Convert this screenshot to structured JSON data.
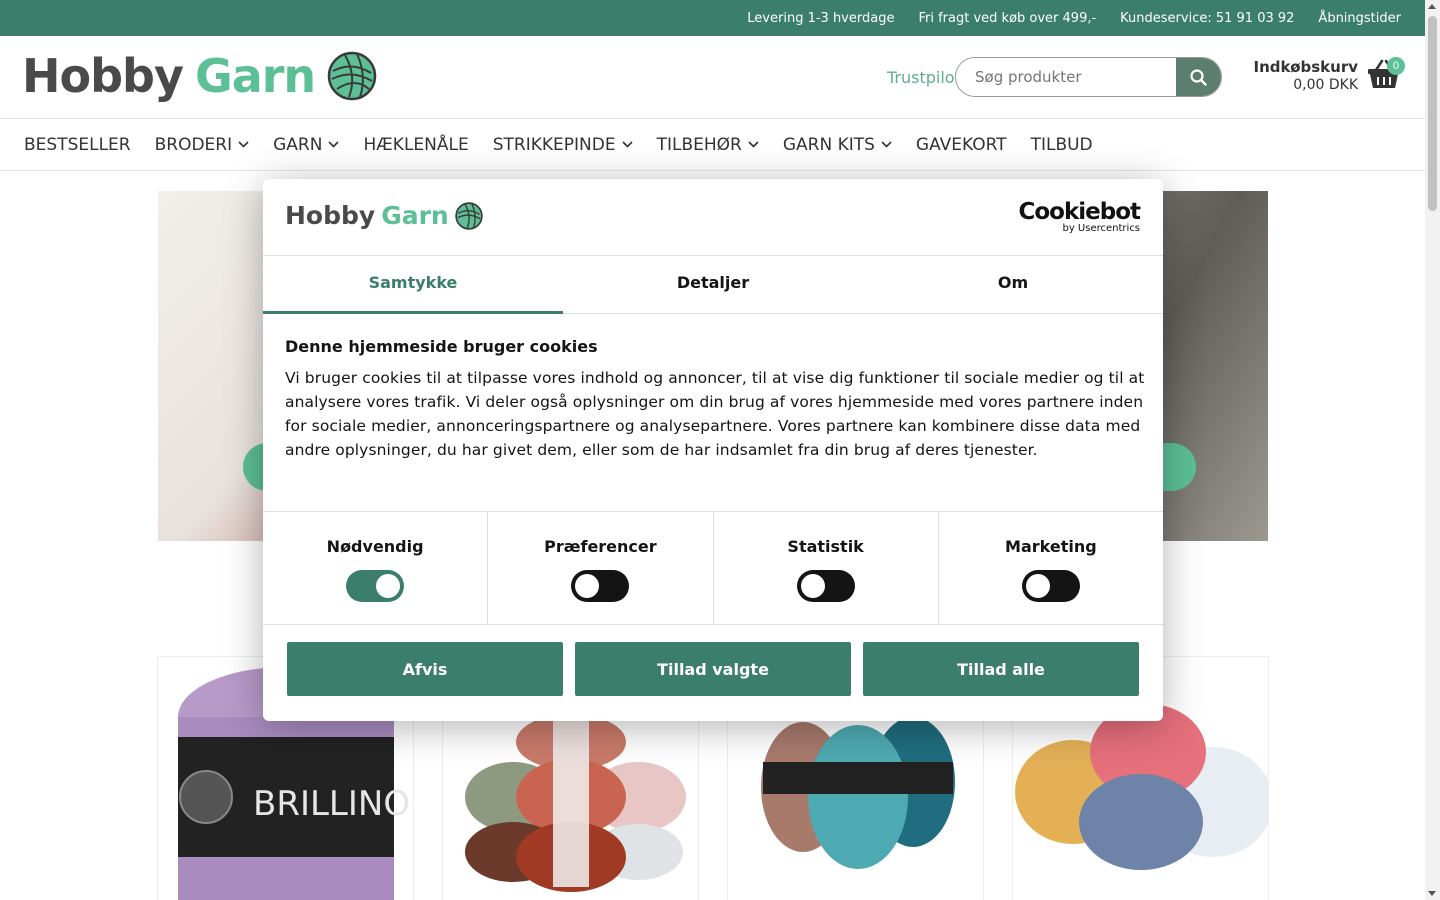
{
  "topbar": {
    "delivery": "Levering 1-3 hverdage",
    "free_shipping": "Fri fragt ved køb over 499,-",
    "customer_service": "Kundeservice: 51 91 03 92",
    "opening_hours": "Åbningstider"
  },
  "header": {
    "logo_word1": "Hobby",
    "logo_word2": "Garn",
    "trustpilot": "Trustpilot",
    "search_placeholder": "Søg produkter",
    "cart_label": "Indkøbskurv",
    "cart_total": "0,00 DKK",
    "cart_count": "0"
  },
  "nav": {
    "items": [
      {
        "label": "BESTSELLER",
        "dropdown": false
      },
      {
        "label": "BRODERI",
        "dropdown": true
      },
      {
        "label": "GARN",
        "dropdown": true
      },
      {
        "label": "HÆKLENÅLE",
        "dropdown": false
      },
      {
        "label": "STRIKKEPINDE",
        "dropdown": true
      },
      {
        "label": "TILBEHØR",
        "dropdown": true
      },
      {
        "label": "GARN KITS",
        "dropdown": true
      },
      {
        "label": "GAVEKORT",
        "dropdown": false
      },
      {
        "label": "TILBUD",
        "dropdown": false
      }
    ]
  },
  "products": {
    "brand_text": "BRILLINO"
  },
  "cookie_dialog": {
    "logo_word1": "Hobby",
    "logo_word2": "Garn",
    "provider_name": "Cookiebot",
    "provider_sub": "by Usercentrics",
    "tabs": [
      "Samtykke",
      "Detaljer",
      "Om"
    ],
    "active_tab": "Samtykke",
    "heading": "Denne hjemmeside bruger cookies",
    "body": "Vi bruger cookies til at tilpasse vores indhold og annoncer, til at vise dig funktioner til sociale medier og til at analysere vores trafik. Vi deler også oplysninger om din brug af vores hjemmeside med vores partnere inden for sociale medier, annonceringspartnere og analysepartnere. Vores partnere kan kombinere disse data med andre oplysninger, du har givet dem, eller som de har indsamlet fra din brug af deres tjenester.",
    "categories": [
      {
        "label": "Nødvendig",
        "enabled": true
      },
      {
        "label": "Præferencer",
        "enabled": false
      },
      {
        "label": "Statistik",
        "enabled": false
      },
      {
        "label": "Marketing",
        "enabled": false
      }
    ],
    "buttons": {
      "decline": "Afvis",
      "allow_selected": "Tillad valgte",
      "allow_all": "Tillad alle"
    }
  },
  "colors": {
    "brand_green": "#3b7e6b",
    "accent_green": "#5cbf95"
  }
}
